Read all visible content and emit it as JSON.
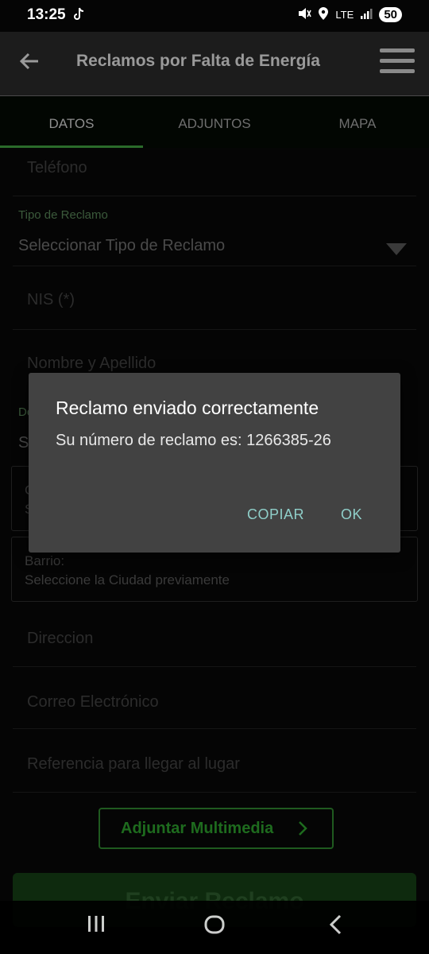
{
  "status_bar": {
    "time": "13:25",
    "network": "LTE",
    "battery": "50",
    "icons": [
      "tiktok-icon",
      "mute-icon",
      "location-icon",
      "signal-icon",
      "battery-icon"
    ]
  },
  "app_bar": {
    "title": "Reclamos por Falta de Energía"
  },
  "tabs": [
    {
      "label": "DATOS",
      "active": true
    },
    {
      "label": "ADJUNTOS",
      "active": false
    },
    {
      "label": "MAPA",
      "active": false
    }
  ],
  "form": {
    "telefono_placeholder": "Teléfono",
    "tipo_reclamo": {
      "label": "Tipo de Reclamo",
      "value": "Seleccionar Tipo de Reclamo"
    },
    "nis_placeholder": "NIS (*)",
    "nombre_placeholder": "Nombre y Apellido",
    "departamento": {
      "label": "Do",
      "value": "S"
    },
    "ciudad": {
      "label": "C",
      "value": "S"
    },
    "barrio": {
      "label": "Barrio:",
      "value": "Seleccione la Ciudad previamente"
    },
    "direccion_placeholder": "Direccion",
    "correo_placeholder": "Correo Electrónico",
    "referencia_placeholder": "Referencia para llegar al lugar",
    "adjuntar_label": "Adjuntar Multimedia",
    "enviar_label": "Enviar Reclamo"
  },
  "dialog": {
    "title": "Reclamo enviado correctamente",
    "message": "Su número de reclamo es: 1266385-26",
    "copy_label": "COPIAR",
    "ok_label": "OK"
  },
  "colors": {
    "accent": "#2a6b2a",
    "dialog_bg": "#424242",
    "dialog_button": "#8fcfc9"
  }
}
